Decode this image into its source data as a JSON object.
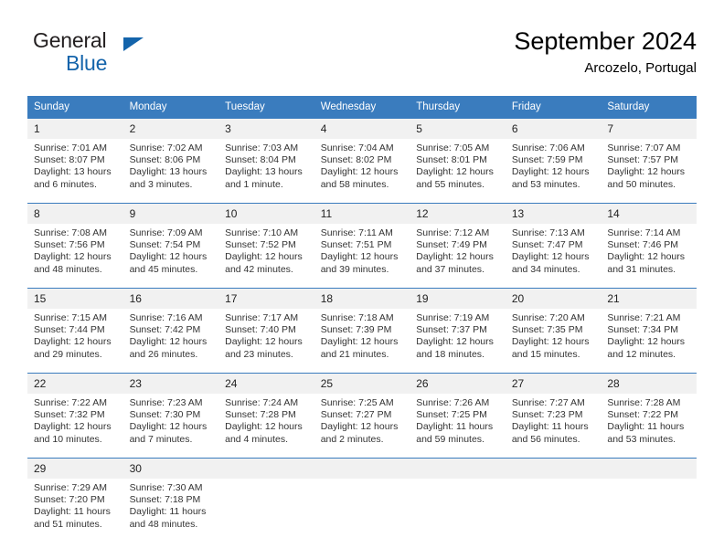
{
  "brand": {
    "name_part1": "General",
    "name_part2": "Blue",
    "flag_icon": "flag-triangle-icon"
  },
  "header": {
    "title": "September 2024",
    "subtitle": "Arcozelo, Portugal"
  },
  "colors": {
    "header_blue": "#3a7cbe",
    "brand_blue": "#1464ab",
    "daynum_band": "#f1f1f1",
    "text": "#333333"
  },
  "weekdays": [
    "Sunday",
    "Monday",
    "Tuesday",
    "Wednesday",
    "Thursday",
    "Friday",
    "Saturday"
  ],
  "weeks": [
    [
      {
        "day": "1",
        "sunrise": "Sunrise: 7:01 AM",
        "sunset": "Sunset: 8:07 PM",
        "daylight": "Daylight: 13 hours and 6 minutes."
      },
      {
        "day": "2",
        "sunrise": "Sunrise: 7:02 AM",
        "sunset": "Sunset: 8:06 PM",
        "daylight": "Daylight: 13 hours and 3 minutes."
      },
      {
        "day": "3",
        "sunrise": "Sunrise: 7:03 AM",
        "sunset": "Sunset: 8:04 PM",
        "daylight": "Daylight: 13 hours and 1 minute."
      },
      {
        "day": "4",
        "sunrise": "Sunrise: 7:04 AM",
        "sunset": "Sunset: 8:02 PM",
        "daylight": "Daylight: 12 hours and 58 minutes."
      },
      {
        "day": "5",
        "sunrise": "Sunrise: 7:05 AM",
        "sunset": "Sunset: 8:01 PM",
        "daylight": "Daylight: 12 hours and 55 minutes."
      },
      {
        "day": "6",
        "sunrise": "Sunrise: 7:06 AM",
        "sunset": "Sunset: 7:59 PM",
        "daylight": "Daylight: 12 hours and 53 minutes."
      },
      {
        "day": "7",
        "sunrise": "Sunrise: 7:07 AM",
        "sunset": "Sunset: 7:57 PM",
        "daylight": "Daylight: 12 hours and 50 minutes."
      }
    ],
    [
      {
        "day": "8",
        "sunrise": "Sunrise: 7:08 AM",
        "sunset": "Sunset: 7:56 PM",
        "daylight": "Daylight: 12 hours and 48 minutes."
      },
      {
        "day": "9",
        "sunrise": "Sunrise: 7:09 AM",
        "sunset": "Sunset: 7:54 PM",
        "daylight": "Daylight: 12 hours and 45 minutes."
      },
      {
        "day": "10",
        "sunrise": "Sunrise: 7:10 AM",
        "sunset": "Sunset: 7:52 PM",
        "daylight": "Daylight: 12 hours and 42 minutes."
      },
      {
        "day": "11",
        "sunrise": "Sunrise: 7:11 AM",
        "sunset": "Sunset: 7:51 PM",
        "daylight": "Daylight: 12 hours and 39 minutes."
      },
      {
        "day": "12",
        "sunrise": "Sunrise: 7:12 AM",
        "sunset": "Sunset: 7:49 PM",
        "daylight": "Daylight: 12 hours and 37 minutes."
      },
      {
        "day": "13",
        "sunrise": "Sunrise: 7:13 AM",
        "sunset": "Sunset: 7:47 PM",
        "daylight": "Daylight: 12 hours and 34 minutes."
      },
      {
        "day": "14",
        "sunrise": "Sunrise: 7:14 AM",
        "sunset": "Sunset: 7:46 PM",
        "daylight": "Daylight: 12 hours and 31 minutes."
      }
    ],
    [
      {
        "day": "15",
        "sunrise": "Sunrise: 7:15 AM",
        "sunset": "Sunset: 7:44 PM",
        "daylight": "Daylight: 12 hours and 29 minutes."
      },
      {
        "day": "16",
        "sunrise": "Sunrise: 7:16 AM",
        "sunset": "Sunset: 7:42 PM",
        "daylight": "Daylight: 12 hours and 26 minutes."
      },
      {
        "day": "17",
        "sunrise": "Sunrise: 7:17 AM",
        "sunset": "Sunset: 7:40 PM",
        "daylight": "Daylight: 12 hours and 23 minutes."
      },
      {
        "day": "18",
        "sunrise": "Sunrise: 7:18 AM",
        "sunset": "Sunset: 7:39 PM",
        "daylight": "Daylight: 12 hours and 21 minutes."
      },
      {
        "day": "19",
        "sunrise": "Sunrise: 7:19 AM",
        "sunset": "Sunset: 7:37 PM",
        "daylight": "Daylight: 12 hours and 18 minutes."
      },
      {
        "day": "20",
        "sunrise": "Sunrise: 7:20 AM",
        "sunset": "Sunset: 7:35 PM",
        "daylight": "Daylight: 12 hours and 15 minutes."
      },
      {
        "day": "21",
        "sunrise": "Sunrise: 7:21 AM",
        "sunset": "Sunset: 7:34 PM",
        "daylight": "Daylight: 12 hours and 12 minutes."
      }
    ],
    [
      {
        "day": "22",
        "sunrise": "Sunrise: 7:22 AM",
        "sunset": "Sunset: 7:32 PM",
        "daylight": "Daylight: 12 hours and 10 minutes."
      },
      {
        "day": "23",
        "sunrise": "Sunrise: 7:23 AM",
        "sunset": "Sunset: 7:30 PM",
        "daylight": "Daylight: 12 hours and 7 minutes."
      },
      {
        "day": "24",
        "sunrise": "Sunrise: 7:24 AM",
        "sunset": "Sunset: 7:28 PM",
        "daylight": "Daylight: 12 hours and 4 minutes."
      },
      {
        "day": "25",
        "sunrise": "Sunrise: 7:25 AM",
        "sunset": "Sunset: 7:27 PM",
        "daylight": "Daylight: 12 hours and 2 minutes."
      },
      {
        "day": "26",
        "sunrise": "Sunrise: 7:26 AM",
        "sunset": "Sunset: 7:25 PM",
        "daylight": "Daylight: 11 hours and 59 minutes."
      },
      {
        "day": "27",
        "sunrise": "Sunrise: 7:27 AM",
        "sunset": "Sunset: 7:23 PM",
        "daylight": "Daylight: 11 hours and 56 minutes."
      },
      {
        "day": "28",
        "sunrise": "Sunrise: 7:28 AM",
        "sunset": "Sunset: 7:22 PM",
        "daylight": "Daylight: 11 hours and 53 minutes."
      }
    ],
    [
      {
        "day": "29",
        "sunrise": "Sunrise: 7:29 AM",
        "sunset": "Sunset: 7:20 PM",
        "daylight": "Daylight: 11 hours and 51 minutes."
      },
      {
        "day": "30",
        "sunrise": "Sunrise: 7:30 AM",
        "sunset": "Sunset: 7:18 PM",
        "daylight": "Daylight: 11 hours and 48 minutes."
      },
      {
        "day": "",
        "sunrise": "",
        "sunset": "",
        "daylight": ""
      },
      {
        "day": "",
        "sunrise": "",
        "sunset": "",
        "daylight": ""
      },
      {
        "day": "",
        "sunrise": "",
        "sunset": "",
        "daylight": ""
      },
      {
        "day": "",
        "sunrise": "",
        "sunset": "",
        "daylight": ""
      },
      {
        "day": "",
        "sunrise": "",
        "sunset": "",
        "daylight": ""
      }
    ]
  ]
}
